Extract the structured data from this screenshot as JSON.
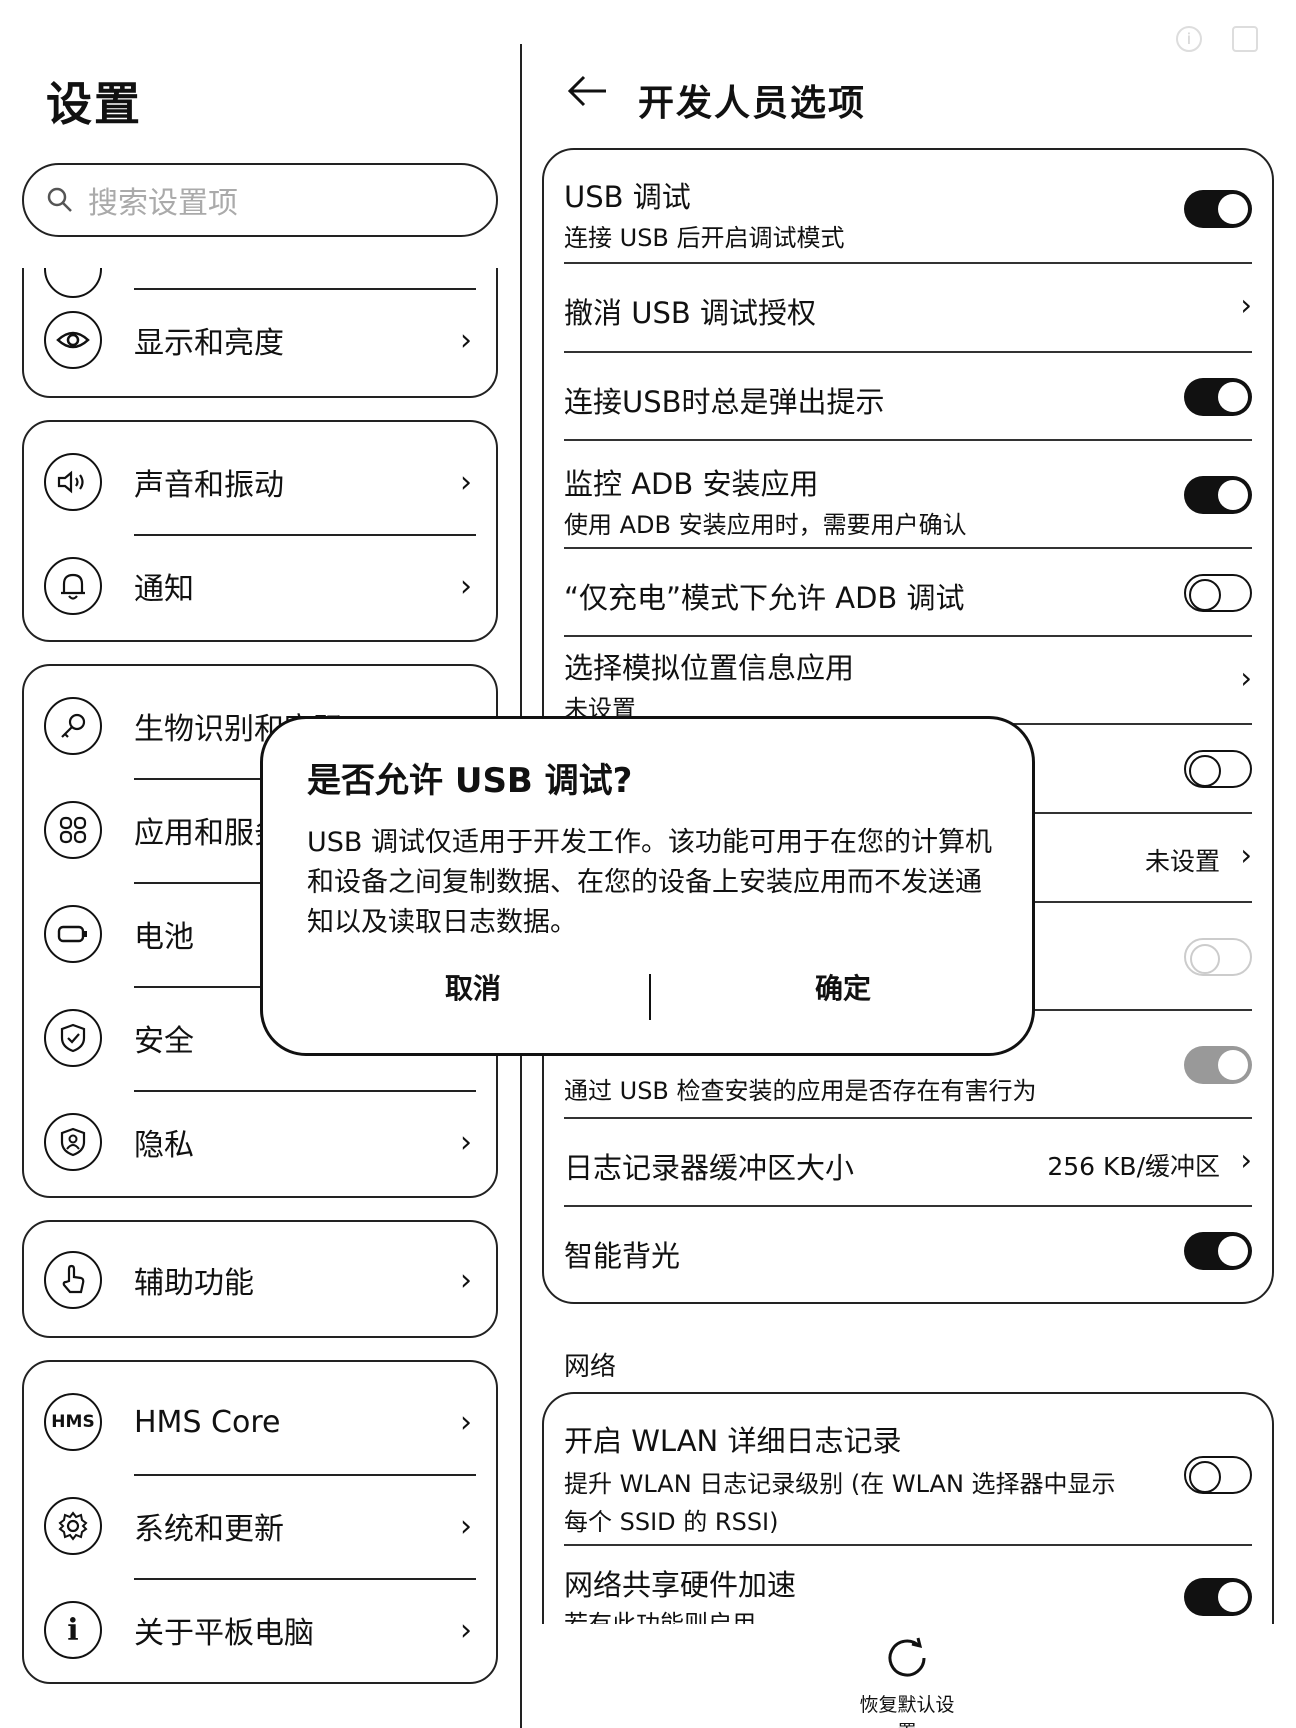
{
  "left": {
    "title": "设置",
    "search_placeholder": "搜索设置项",
    "card1": [
      {
        "label": "显示和亮度",
        "icon": "eye-icon"
      }
    ],
    "card2": [
      {
        "label": "声音和振动",
        "icon": "speaker-icon"
      },
      {
        "label": "通知",
        "icon": "bell-icon"
      }
    ],
    "card3": [
      {
        "label": "生物识别和密码",
        "icon": "key-icon"
      },
      {
        "label": "应用和服务",
        "icon": "apps-grid-icon"
      },
      {
        "label": "电池",
        "icon": "battery-icon"
      },
      {
        "label": "安全",
        "icon": "shield-check-icon"
      },
      {
        "label": "隐私",
        "icon": "privacy-shield-icon"
      }
    ],
    "card4": [
      {
        "label": "辅助功能",
        "icon": "hand-pointer-icon"
      }
    ],
    "card5": [
      {
        "label": "HMS Core",
        "icon": "hms-icon"
      },
      {
        "label": "系统和更新",
        "icon": "gear-icon"
      },
      {
        "label": "关于平板电脑",
        "icon": "info-icon"
      }
    ],
    "chevron": "›"
  },
  "right": {
    "title": "开发人员选项",
    "rows": {
      "usb_debug": {
        "title": "USB 调试",
        "sub": "连接 USB 后开启调试模式",
        "toggle": "on"
      },
      "revoke": {
        "title": "撤消 USB 调试授权"
      },
      "usb_prompt": {
        "title": "连接USB时总是弹出提示",
        "toggle": "on"
      },
      "adb_monitor": {
        "title": "监控 ADB 安装应用",
        "sub": "使用 ADB 安装应用时，需要用户确认",
        "toggle": "on"
      },
      "charge_adb": {
        "title": "“仅充电”模式下允许 ADB 调试",
        "toggle": "off"
      },
      "mock_location": {
        "title": "选择模拟位置信息应用",
        "sub": "未设置"
      },
      "hidden1": {
        "toggle": "off"
      },
      "hidden2": {
        "value": "未设置"
      },
      "hidden3": {
        "toggle": "disabled"
      },
      "usb_verify": {
        "sub": "通过 USB 检查安装的应用是否存在有害行为",
        "toggle": "gray-on"
      },
      "log_buffer": {
        "title": "日志记录器缓冲区大小",
        "value": "256 KB/缓冲区"
      },
      "smart_backlight": {
        "title": "智能背光",
        "toggle": "on"
      }
    },
    "network_label": "网络",
    "network": {
      "wlan_log": {
        "title": "开启 WLAN 详细日志记录",
        "sub1": "提升 WLAN 日志记录级别 (在 WLAN 选择器中显示",
        "sub2": "每个 SSID 的 RSSI)",
        "toggle": "off"
      },
      "tether_hw": {
        "title": "网络共享硬件加速",
        "sub": "若有此功能则启用",
        "toggle": "on"
      }
    },
    "restore_label": "恢复默认设置"
  },
  "dialog": {
    "title": "是否允许 USB 调试?",
    "message": "USB 调试仅适用于开发工作。该功能可用于在您的计算机和设备之间复制数据、在您的设备上安装应用而不发送通知以及读取日志数据。",
    "cancel": "取消",
    "ok": "确定"
  }
}
